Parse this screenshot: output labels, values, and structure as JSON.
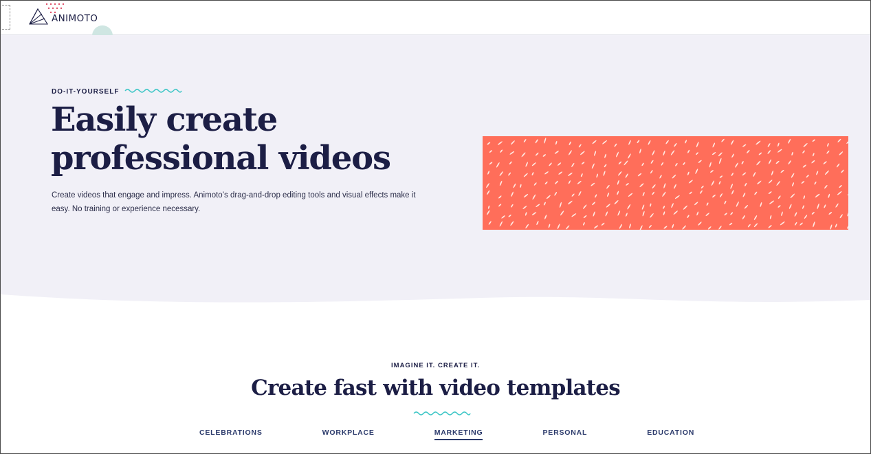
{
  "header": {
    "logo_text": "ANIMOTO"
  },
  "hero": {
    "eyebrow": "DO-IT-YOURSELF",
    "title_line1": "Easily create",
    "title_line2": "professional videos",
    "description": "Create videos that engage and impress. Animoto’s drag-and-drop editing tools and visual effects make it easy. No training or experience necessary.",
    "image_color": "#ff6e5a"
  },
  "templates": {
    "eyebrow": "IMAGINE IT. CREATE IT.",
    "title": "Create fast with video templates",
    "tabs": [
      {
        "label": "CELEBRATIONS"
      },
      {
        "label": "WORKPLACE"
      },
      {
        "label": "MARKETING",
        "active": true
      },
      {
        "label": "PERSONAL"
      },
      {
        "label": "EDUCATION"
      }
    ]
  },
  "colors": {
    "navy": "#1c1e45",
    "hero_bg": "#f1f0f7",
    "accent_teal": "#3cc6c6",
    "coral": "#ff6e5a"
  }
}
